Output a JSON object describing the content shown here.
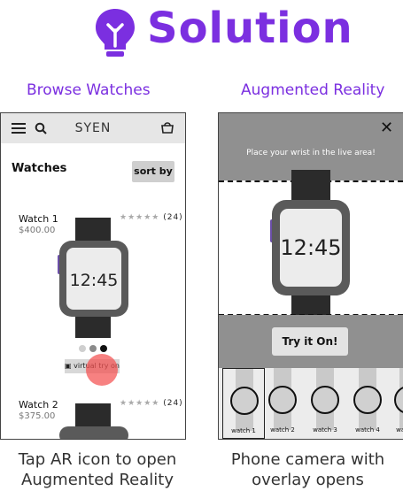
{
  "title": "Solution",
  "icon": "lightbulb-icon",
  "accent": "#7b2fe0",
  "browse": {
    "label": "Browse Watches",
    "brand": "SYEN",
    "heading": "Watches",
    "sort_label": "sort by",
    "menu_icon": "hamburger-menu-icon",
    "search_icon": "search-icon",
    "cart_icon": "cart-icon",
    "items": [
      {
        "name": "Watch 1",
        "price": "$400.00",
        "rating_count": "(24)",
        "time": "12:45"
      },
      {
        "name": "Watch 2",
        "price": "$375.00",
        "rating_count": "(24)"
      }
    ],
    "try_on_label": "virtual try on",
    "caption": "Tap AR icon to open\nAugmented Reality"
  },
  "ar": {
    "label": "Augmented Reality",
    "instruction": "Place your wrist in the live area!",
    "time": "12:45",
    "try_button": "Try it On!",
    "close_icon": "close-icon",
    "thumbnails": [
      "watch 1",
      "watch 2",
      "watch 3",
      "watch 4",
      "watch 5"
    ],
    "caption": "Phone camera with\noverlay opens"
  }
}
